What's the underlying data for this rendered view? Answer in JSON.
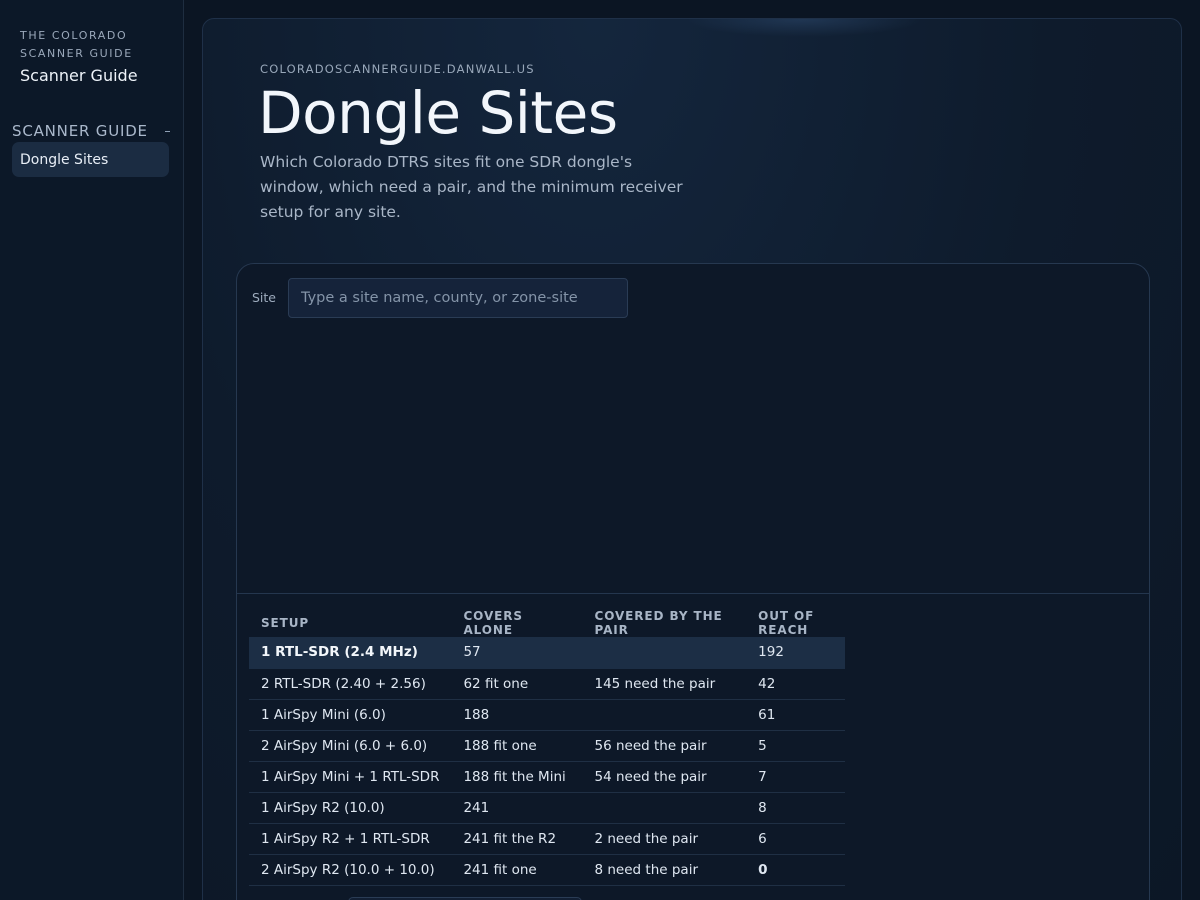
{
  "sidebar": {
    "brand_small": "THE COLORADO SCANNER GUIDE",
    "brand_title": "Scanner Guide",
    "section_label": "SCANNER GUIDE",
    "items": [
      {
        "label": "Dongle Sites",
        "active": true
      }
    ]
  },
  "header": {
    "domain": "COLORADOSCANNERGUIDE.DANWALL.US",
    "title": "Dongle Sites",
    "description": "Which Colorado DTRS sites fit one SDR dongle's window, which need a pair, and the minimum receiver setup for any site."
  },
  "search": {
    "label": "Site",
    "value": "",
    "placeholder": "Type a site name, county, or zone-site"
  },
  "table": {
    "columns": [
      "SETUP",
      "COVERS ALONE",
      "COVERED BY THE PAIR",
      "OUT OF REACH"
    ],
    "rows": [
      {
        "setup": "1 RTL-SDR (2.4 MHz)",
        "alone": "57",
        "pair": "",
        "out": "192",
        "selected": true
      },
      {
        "setup": "2 RTL-SDR (2.40 + 2.56)",
        "alone": "62 fit one",
        "pair": "145 need the pair",
        "out": "42"
      },
      {
        "setup": "1 AirSpy Mini (6.0)",
        "alone": "188",
        "pair": "",
        "out": "61"
      },
      {
        "setup": "2 AirSpy Mini (6.0 + 6.0)",
        "alone": "188 fit one",
        "pair": "56 need the pair",
        "out": "5"
      },
      {
        "setup": "1 AirSpy Mini + 1 RTL-SDR",
        "alone": "188 fit the Mini",
        "pair": "54 need the pair",
        "out": "7"
      },
      {
        "setup": "1 AirSpy R2 (10.0)",
        "alone": "241",
        "pair": "",
        "out": "8"
      },
      {
        "setup": "1 AirSpy R2 + 1 RTL-SDR",
        "alone": "241 fit the R2",
        "pair": "2 need the pair",
        "out": "6"
      },
      {
        "setup": "2 AirSpy R2 (10.0 + 10.0)",
        "alone": "241 fit one",
        "pair": "8 need the pair",
        "out": "0"
      }
    ]
  },
  "colors": {
    "background": "#0b1523",
    "selected_row": "#1c2e45",
    "accent_nav": "#1b2c42"
  }
}
